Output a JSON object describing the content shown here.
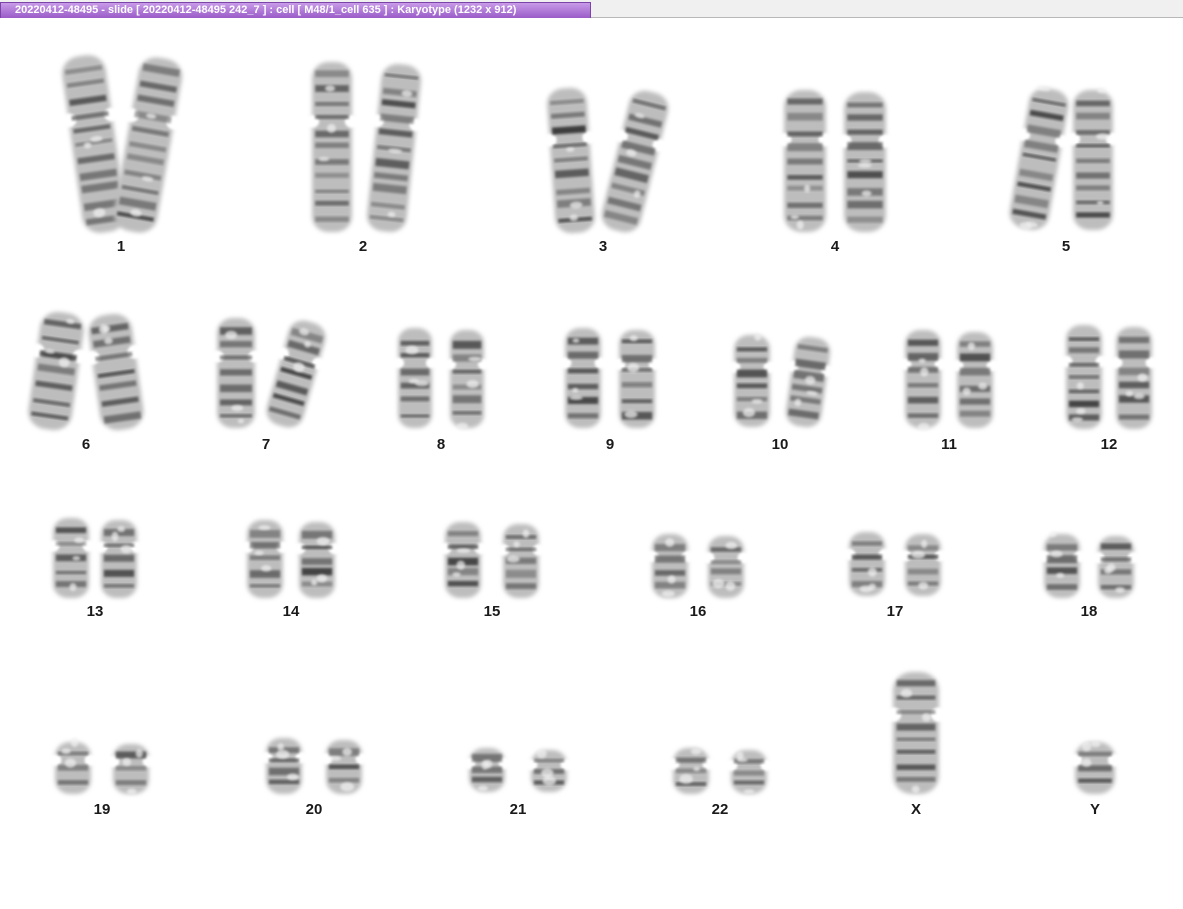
{
  "window": {
    "title": "20220412-48495 - slide [ 20220412-48495 242_7 ] : cell [ M48/1_cell 635 ] : Karyotype  (1232 x 912)",
    "accent_color": "#a56bd2"
  },
  "karyotype": {
    "labels": [
      "1",
      "2",
      "3",
      "4",
      "5",
      "6",
      "7",
      "8",
      "9",
      "10",
      "11",
      "12",
      "13",
      "14",
      "15",
      "16",
      "17",
      "18",
      "19",
      "20",
      "21",
      "22",
      "X",
      "Y"
    ]
  }
}
